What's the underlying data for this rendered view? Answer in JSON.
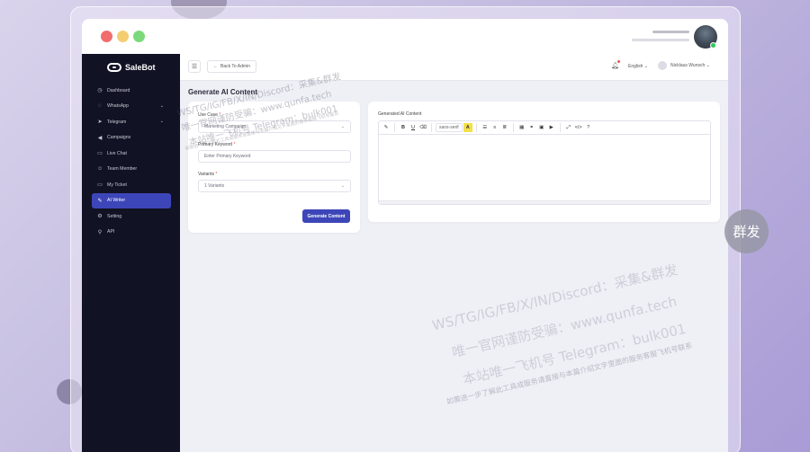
{
  "app": {
    "logo_text": "SaleBot"
  },
  "sidebar": {
    "items": [
      {
        "label": "Dashboard",
        "icon": "dashboard-icon",
        "glyph": "◷",
        "has_chevron": false,
        "active": false
      },
      {
        "label": "WhatsApp",
        "icon": "whatsapp-icon",
        "glyph": "◌",
        "has_chevron": true,
        "active": false
      },
      {
        "label": "Telegram",
        "icon": "telegram-icon",
        "glyph": "➤",
        "has_chevron": true,
        "active": false
      },
      {
        "label": "Campaigns",
        "icon": "megaphone-icon",
        "glyph": "◀",
        "has_chevron": false,
        "active": false
      },
      {
        "label": "Live Chat",
        "icon": "chat-icon",
        "glyph": "▭",
        "has_chevron": false,
        "active": false
      },
      {
        "label": "Team Member",
        "icon": "user-icon",
        "glyph": "☺",
        "has_chevron": false,
        "active": false
      },
      {
        "label": "My Ticket",
        "icon": "ticket-icon",
        "glyph": "▭",
        "has_chevron": false,
        "active": false
      },
      {
        "label": "AI Writer",
        "icon": "pen-icon",
        "glyph": "✎",
        "has_chevron": false,
        "active": true
      },
      {
        "label": "Setting",
        "icon": "gear-icon",
        "glyph": "⚙",
        "has_chevron": false,
        "active": false
      },
      {
        "label": "API",
        "icon": "link-icon",
        "glyph": "⚲",
        "has_chevron": false,
        "active": false
      }
    ]
  },
  "header": {
    "back_label": "Back To Admin",
    "language": "English",
    "user_name": "Nicklaus Wunsch"
  },
  "main": {
    "page_title": "Generate AI Content",
    "use_case": {
      "label": "Use Case",
      "value": "Marketing Campaign"
    },
    "primary_keyword": {
      "label": "Primary Keyword",
      "placeholder": "Enter Primary Keyword"
    },
    "variants": {
      "label": "Variants",
      "value": "1 Variants"
    },
    "generate_button": "Generate Content",
    "editor": {
      "label": "Generated AI Content",
      "font_name": "sans-serif",
      "content": ""
    }
  },
  "watermarks": [
    "WS/TG/IG/FB/X/IN/Discord：采集&群发",
    "唯一官网谨防受骗：www.qunfa.tech",
    "本站唯一飞机号 Telegram：bulk001",
    "如需进一步了解此工具或服务请直接与本篇介绍文字里面的服务客服飞机号联系"
  ],
  "badge_text": "群发",
  "colors": {
    "sidebar_bg": "#111224",
    "accent": "#3d46b8",
    "required": "#e74c3c"
  }
}
